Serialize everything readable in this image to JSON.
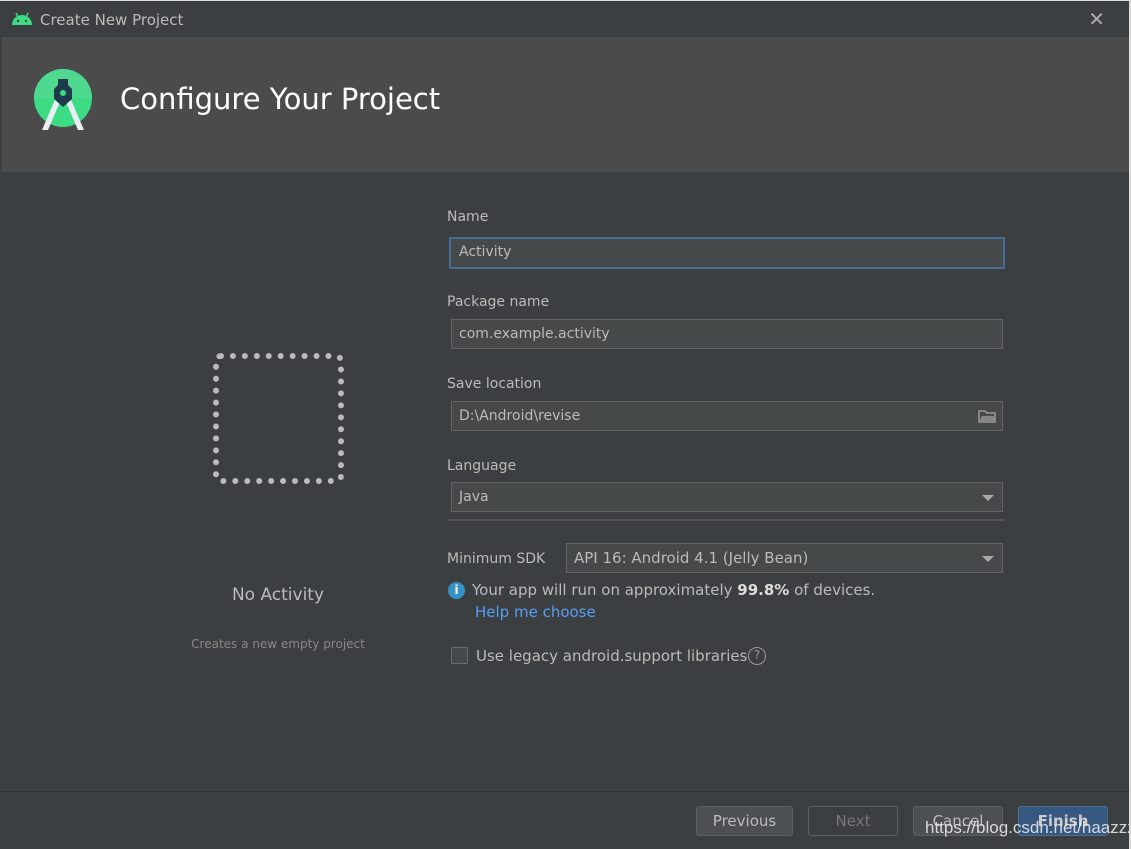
{
  "window": {
    "title": "Create New Project",
    "close_icon": "close-icon"
  },
  "header": {
    "title": "Configure Your Project"
  },
  "template": {
    "name": "No Activity",
    "description": "Creates a new empty project"
  },
  "form": {
    "name": {
      "label": "Name",
      "value": "Activity"
    },
    "package": {
      "label": "Package name",
      "value": "com.example.activity"
    },
    "location": {
      "label": "Save location",
      "value": "D:\\Android\\revise"
    },
    "language": {
      "label": "Language",
      "value": "Java"
    },
    "min_sdk": {
      "label": "Minimum SDK",
      "value": "API 16: Android 4.1 (Jelly Bean)"
    },
    "info": {
      "prefix": "Your app will run on approximately ",
      "percent": "99.8%",
      "suffix": " of devices.",
      "help_link": "Help me choose"
    },
    "legacy": {
      "label": "Use legacy android.support libraries",
      "checked": false
    }
  },
  "buttons": {
    "previous": "Previous",
    "next": "Next",
    "cancel": "Cancel",
    "finish": "Finish"
  },
  "watermark": "https://blog.csdn.net/haazzz",
  "colors": {
    "accent": "#365880",
    "android_green": "#3ddc84",
    "link": "#589df6"
  }
}
